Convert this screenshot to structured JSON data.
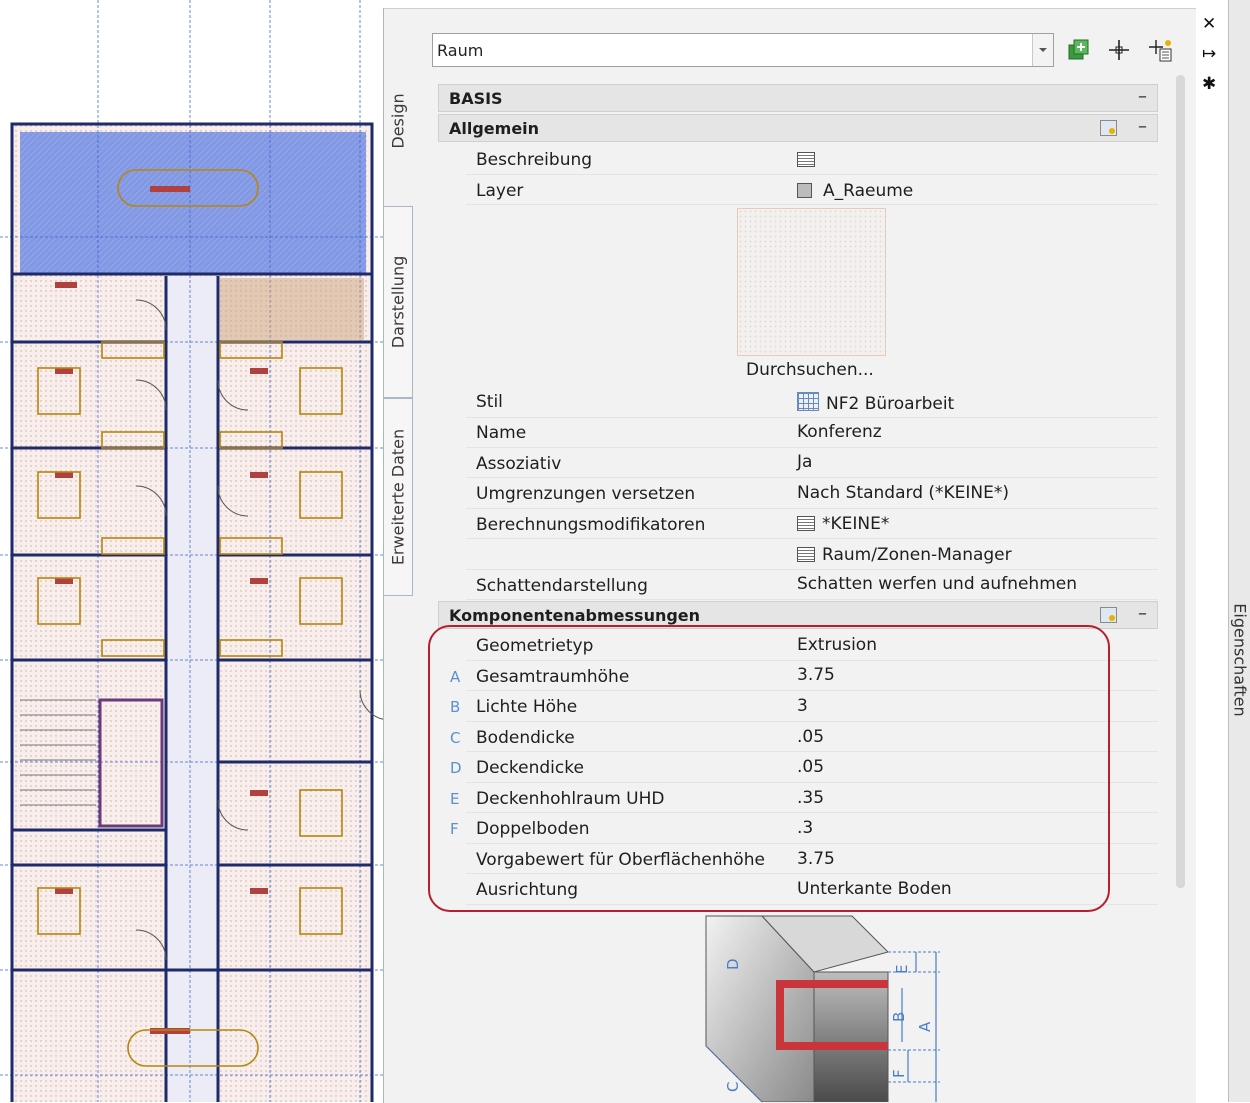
{
  "selector": {
    "value": "Raum"
  },
  "icons": {
    "add": "add-style-icon",
    "select": "select-objects-icon",
    "quick": "quick-select-icon",
    "close": "close-icon",
    "autohide": "auto-hide-icon",
    "settings": "settings-icon"
  },
  "tabs": {
    "design": "Design",
    "display": "Darstellung",
    "extended": "Erweiterte Daten"
  },
  "sections": {
    "basis": "BASIS",
    "general": "Allgemein",
    "dimensions": "Komponentenabmessungen"
  },
  "general": {
    "description": {
      "label": "Beschreibung"
    },
    "layer": {
      "label": "Layer",
      "value": "A_Raeume"
    },
    "browse": "Durchsuchen...",
    "style": {
      "label": "Stil",
      "value": "NF2 Büroarbeit"
    },
    "name": {
      "label": "Name",
      "value": "Konferenz"
    },
    "associative": {
      "label": "Assoziativ",
      "value": "Ja"
    },
    "offset": {
      "label": "Umgrenzungen versetzen",
      "value": "Nach Standard (*KEINE*)"
    },
    "modifiers": {
      "label": "Berechnungsmodifikatoren",
      "value": "*KEINE*"
    },
    "manager": "Raum/Zonen-Manager",
    "shadow": {
      "label": "Schattendarstellung",
      "value": "Schatten werfen und aufnehmen"
    }
  },
  "dimensions": [
    {
      "letter": "",
      "label": "Geometrietyp",
      "value": "Extrusion"
    },
    {
      "letter": "A",
      "label": "Gesamtraumhöhe",
      "value": "3.75"
    },
    {
      "letter": "B",
      "label": "Lichte Höhe",
      "value": "3"
    },
    {
      "letter": "C",
      "label": "Bodendicke",
      "value": ".05"
    },
    {
      "letter": "D",
      "label": "Deckendicke",
      "value": ".05"
    },
    {
      "letter": "E",
      "label": "Deckenhohlraum UHD",
      "value": ".35"
    },
    {
      "letter": "F",
      "label": "Doppelboden",
      "value": ".3"
    },
    {
      "letter": "",
      "label": "Vorgabewert für Oberflächenhöhe",
      "value": "3.75"
    },
    {
      "letter": "",
      "label": "Ausrichtung",
      "value": "Unterkante Boden"
    }
  ],
  "diagram": {
    "labels": [
      "E",
      "D",
      "B",
      "A",
      "F",
      "C"
    ]
  },
  "palette": {
    "title": "Eigenschaften"
  },
  "colors": {
    "highlight": "#b51f2e",
    "selected_room": "#7a92e6",
    "walls": "#1f2a6b",
    "room_fill": "#f6e6e2",
    "furniture": "#b8860b"
  }
}
